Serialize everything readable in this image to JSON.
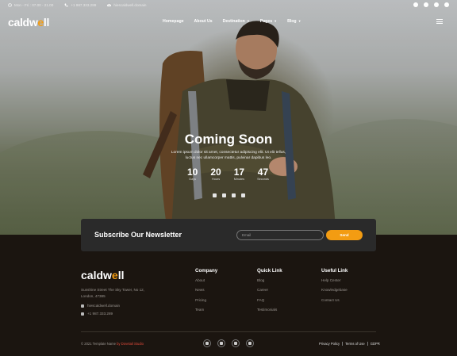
{
  "topbar": {
    "hours": "Mon - Fri : 07.00 - 21.00",
    "phone": "+1 987.333.289",
    "email": "hiescaldwell.domain",
    "socials": [
      "facebook-icon",
      "twitter-icon",
      "instagram-icon",
      "youtube-icon"
    ]
  },
  "brand": {
    "pre": "caldw",
    "accent": "e",
    "post": "ll",
    "accent_color": "#f39c12"
  },
  "nav": {
    "items": [
      {
        "label": "Homepage",
        "caret": false
      },
      {
        "label": "About Us",
        "caret": false
      },
      {
        "label": "Destination",
        "caret": true
      },
      {
        "label": "Pages",
        "caret": true
      },
      {
        "label": "Blog",
        "caret": true
      }
    ]
  },
  "hero": {
    "title": "Coming Soon",
    "description": "Lorem ipsum dolor sit amet, consectetur adipiscing elit. Ut elit tellus, luctus nec ullamcorper mattis, pulvinar dapibus leo.",
    "countdown": [
      {
        "value": "10",
        "label": "Days"
      },
      {
        "value": "20",
        "label": "Hours"
      },
      {
        "value": "17",
        "label": "Minutes"
      },
      {
        "value": "47",
        "label": "Seconds"
      }
    ]
  },
  "newsletter": {
    "title": "Subscribe Our Newsletter",
    "placeholder": "Email",
    "button": "Send"
  },
  "footer": {
    "address": "Sunshine Street The Sky Tower, No 12, London, 47385",
    "email": "hiescaldwell.domain",
    "phone": "+1 987.333.289",
    "columns": [
      {
        "title": "Company",
        "links": [
          "About",
          "News",
          "Pricing",
          "Team"
        ]
      },
      {
        "title": "Quick Link",
        "links": [
          "Blog",
          "Career",
          "FAQ",
          "Testimonials"
        ]
      },
      {
        "title": "Useful Link",
        "links": [
          "Help Center",
          "Knowledgebase",
          "Contact Us"
        ]
      }
    ],
    "copyright": "© 2021 Template Name",
    "copyright_by": "by Dovetail Studio",
    "legal": [
      "Privacy Policy",
      "Terms of Use",
      "GDPR"
    ]
  }
}
